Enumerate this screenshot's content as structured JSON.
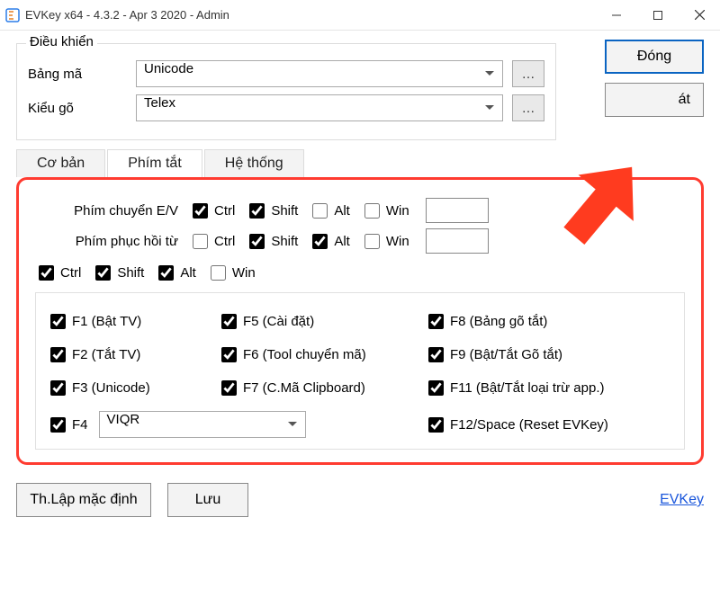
{
  "window": {
    "title": "EVKey x64 - 4.3.2 - Apr  3 2020 - Admin"
  },
  "control_group": {
    "legend": "Điều khiển",
    "bang_ma_label": "Bảng mã",
    "bang_ma_value": "Unicode",
    "kieu_go_label": "Kiểu gõ",
    "kieu_go_value": "Telex"
  },
  "buttons": {
    "close": "Đóng",
    "exit_partial": "át"
  },
  "tabs": {
    "basic": "Cơ bản",
    "shortcuts": "Phím tắt",
    "system": "Hệ thống"
  },
  "shortcut_panel": {
    "row1_label": "Phím chuyển E/V",
    "row2_label": "Phím phục hồi từ",
    "mod_ctrl": "Ctrl",
    "mod_shift": "Shift",
    "mod_alt": "Alt",
    "mod_win": "Win",
    "row1": {
      "ctrl": true,
      "shift": true,
      "alt": false,
      "win": false
    },
    "row2": {
      "ctrl": false,
      "shift": true,
      "alt": true,
      "win": false
    },
    "global_mods": {
      "ctrl": true,
      "shift": true,
      "alt": true,
      "win": false
    },
    "fkeys": {
      "f1": {
        "checked": true,
        "label": "F1 (Bật TV)"
      },
      "f2": {
        "checked": true,
        "label": "F2 (Tắt TV)"
      },
      "f3": {
        "checked": true,
        "label": "F3 (Unicode)"
      },
      "f4": {
        "checked": true,
        "label": "F4",
        "select_value": "VIQR"
      },
      "f5": {
        "checked": true,
        "label": "F5 (Cài đặt)"
      },
      "f6": {
        "checked": true,
        "label": "F6 (Tool chuyển mã)"
      },
      "f7": {
        "checked": true,
        "label": "F7 (C.Mã Clipboard)"
      },
      "f8": {
        "checked": true,
        "label": "F8 (Bảng gõ tắt)"
      },
      "f9": {
        "checked": true,
        "label": "F9 (Bật/Tắt Gõ tắt)"
      },
      "f11": {
        "checked": true,
        "label": "F11 (Bật/Tắt loại trừ app.)"
      },
      "f12": {
        "checked": true,
        "label": "F12/Space (Reset EVKey)"
      }
    }
  },
  "footer": {
    "default": "Th.Lập mặc định",
    "save": "Lưu",
    "link": "EVKey"
  }
}
